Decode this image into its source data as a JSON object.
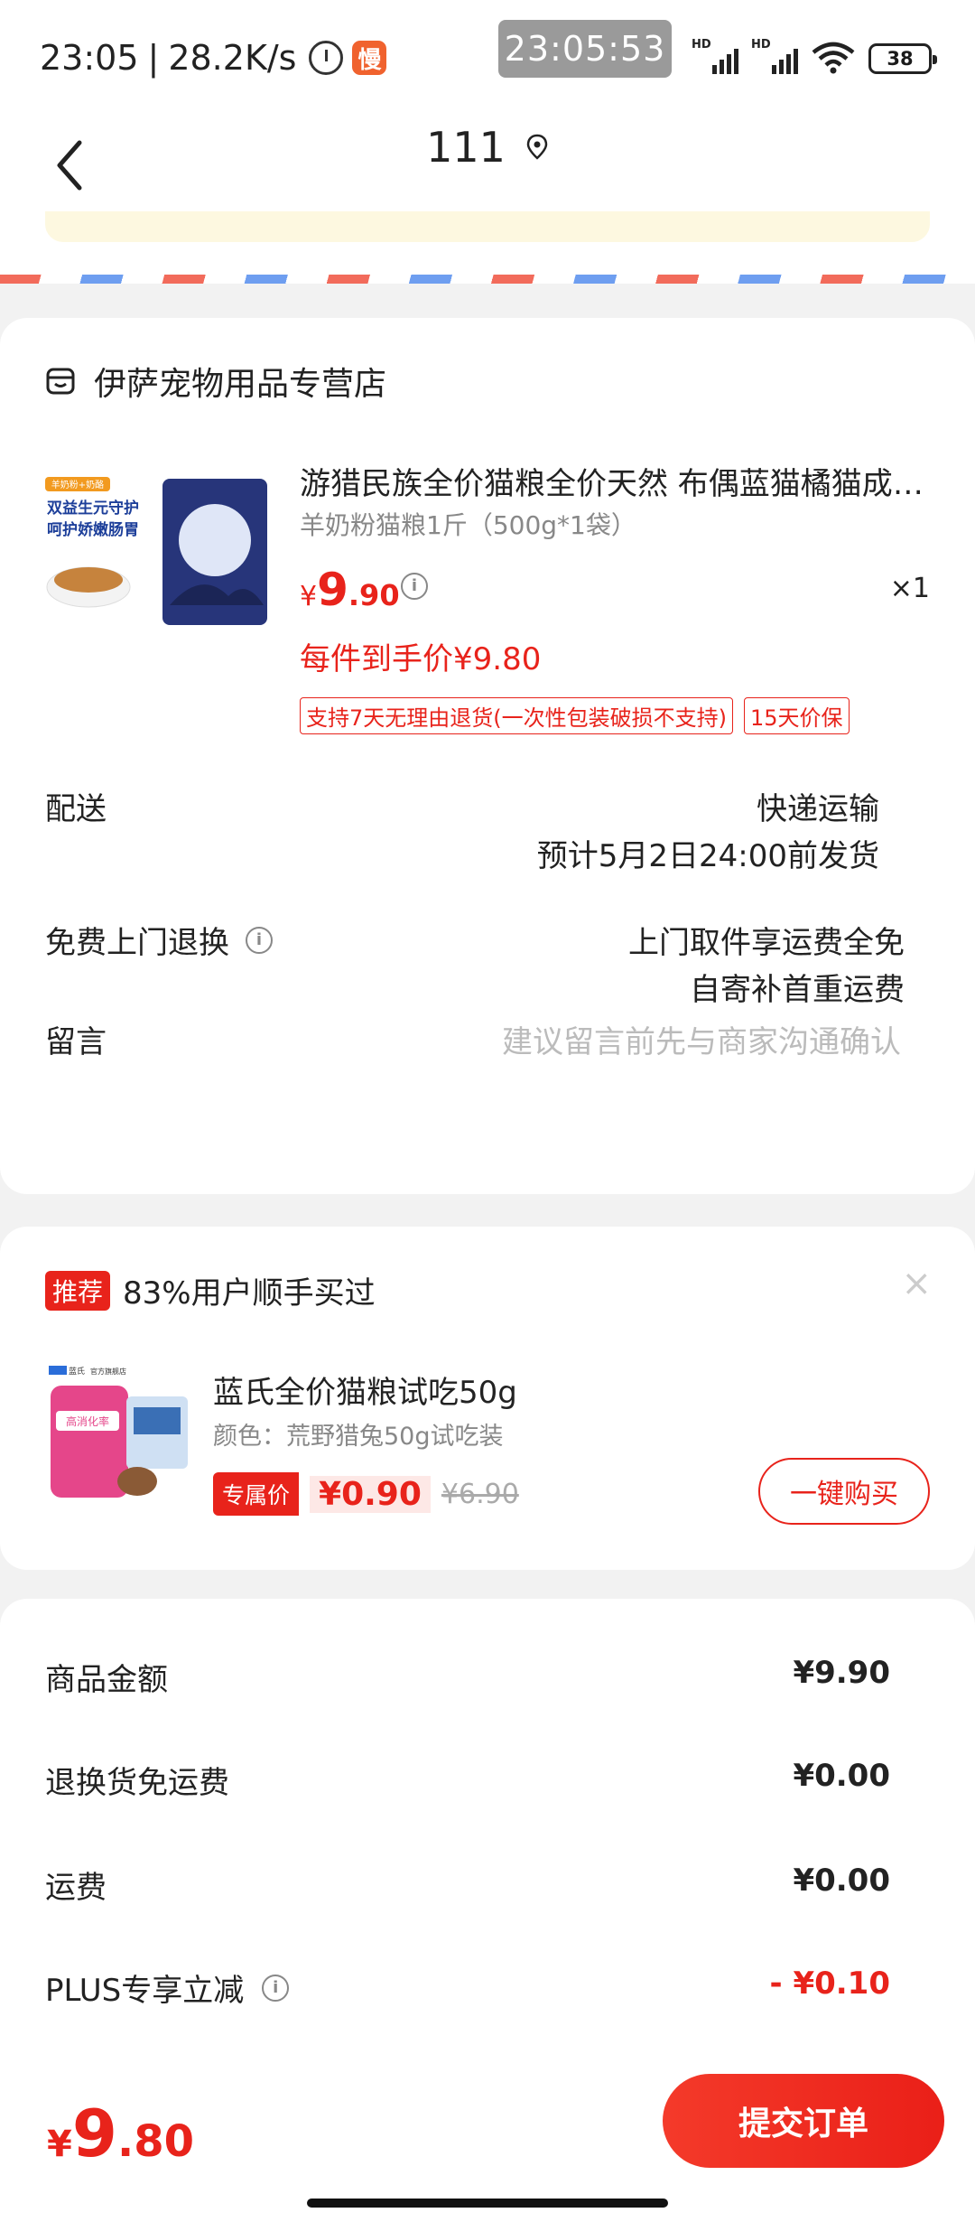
{
  "status_bar": {
    "time": "23:05",
    "net_speed": "28.2K/s",
    "app_badge": "慢",
    "clock_overlay": "23:05:53",
    "hd1": "HD",
    "hd2": "HD",
    "battery": "38"
  },
  "nav": {
    "title": "111"
  },
  "store": {
    "name": "伊萨宠物用品专营店",
    "product": {
      "title": "游猎民族全价猫粮全价天然 布偶蓝猫橘猫成猫幼猫",
      "spec": "羊奶粉猫粮1斤（500g*1袋）",
      "price_currency": "¥",
      "price_int": "9",
      "price_dec": ".90",
      "qty": "×1",
      "final_price": "每件到手价¥9.80",
      "tags": [
        "支持7天无理由退货(一次性包装破损不支持)",
        "15天价保"
      ],
      "image_text": [
        "羊奶粉+奶酪",
        "双益生元守护",
        "呵护娇嫩肠胃"
      ]
    },
    "shipping": {
      "label": "配送",
      "method": "快递运输",
      "eta": "预计5月2日24:00前发货"
    },
    "returns": {
      "label": "免费上门退换",
      "line1": "上门取件享运费全免",
      "line2": "自寄补首重运费"
    },
    "message": {
      "label": "留言",
      "placeholder": "建议留言前先与商家沟通确认"
    }
  },
  "recommend": {
    "badge": "推荐",
    "headline": "83%用户顺手买过",
    "close": "×",
    "product": {
      "title": "蓝氏全价猫粮试吃50g",
      "spec": "颜色：荒野猎兔50g试吃装",
      "price_badge": "专属价",
      "price": "¥0.90",
      "old_price": "¥6.90",
      "buy_label": "一键购买",
      "image_text": [
        "蓝氏",
        "官方旗舰店",
        "高消化率"
      ]
    }
  },
  "summary": {
    "rows": [
      {
        "label": "商品金额",
        "value": "¥9.90"
      },
      {
        "label": "退换货免运费",
        "value": "¥0.00"
      },
      {
        "label": "运费",
        "value": "¥0.00"
      },
      {
        "label": "PLUS专享立减",
        "value": "- ¥0.10"
      }
    ]
  },
  "bottom": {
    "total_currency": "¥",
    "total_int": "9",
    "total_dec": ".80",
    "submit_label": "提交订单"
  },
  "colors": {
    "accent": "#e8231b",
    "background": "#f2f2f2"
  }
}
